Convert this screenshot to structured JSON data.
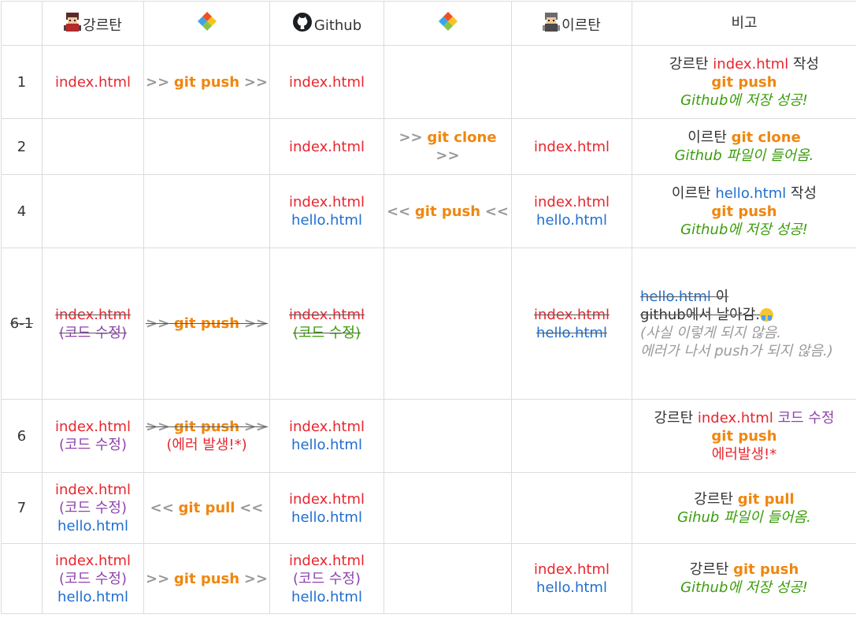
{
  "header": {
    "col1_name": "강르탄",
    "col3_name": "Github",
    "col5_name": "이르탄",
    "col6_name": "비고",
    "icons": {
      "col1": "character-icon",
      "col2": "git-logo-icon",
      "col3": "github-logo-icon",
      "col4": "git-logo-icon",
      "col5": "character-icon"
    }
  },
  "rows": [
    {
      "idx": "1",
      "c1_file": "index.html",
      "c2_arrow_l": ">>",
      "c2_cmd": "git push",
      "c2_arrow_r": ">>",
      "c3_file": "index.html",
      "note_person": "강르탄",
      "note_file": "index.html",
      "note_action": "작성",
      "note_cmd": "git push",
      "note_result": "Github에 저장 성공!"
    },
    {
      "idx": "2",
      "c3_file": "index.html",
      "c4_arrow_l": ">>",
      "c4_cmd": "git clone",
      "c4_arrow_r": ">>",
      "c5_file": "index.html",
      "note_person": "이르탄",
      "note_cmd": "git clone",
      "note_result": "Github 파일이 들어옴."
    },
    {
      "idx": "4",
      "c3_file1": "index.html",
      "c3_file2": "hello.html",
      "c4_arrow_l": "<<",
      "c4_cmd": "git push",
      "c4_arrow_r": "<<",
      "c5_file1": "index.html",
      "c5_file2": "hello.html",
      "note_person": "이르탄",
      "note_file": "hello.html",
      "note_action": "작성",
      "note_cmd": "git push",
      "note_result": "Github에 저장 성공!"
    },
    {
      "idx": "6-1",
      "c1_file": "index.html",
      "c1_edit": "(코드 수정)",
      "c2_arrow_l": ">>",
      "c2_cmd": "git push",
      "c2_arrow_r": ">>",
      "c3_file": "index.html",
      "c3_edit": "(코드 수정)",
      "c5_file1": "index.html",
      "c5_file2": "hello.html",
      "note_file": "hello.html",
      "note_text1": "이",
      "note_text2": "github에서 날아감.",
      "note_italic1": "(사실 이렇게 되지 않음.",
      "note_italic2": "에러가 나서 push가 되지 않음.)"
    },
    {
      "idx": "6",
      "c1_file": "index.html",
      "c1_edit": "(코드 수정)",
      "c2_arrow_l": ">>",
      "c2_cmd": "git push",
      "c2_arrow_r": ">>",
      "c2_error": "(에러 발생!*)",
      "c3_file1": "index.html",
      "c3_file2": "hello.html",
      "note_person": "강르탄",
      "note_file": "index.html",
      "note_edit": "코드 수정",
      "note_cmd": "git push",
      "note_error": "에러발생!*"
    },
    {
      "idx": "7",
      "c1_file1": "index.html",
      "c1_edit": "(코드 수정)",
      "c1_file2": "hello.html",
      "c2_arrow_l": "<<",
      "c2_cmd": "git pull",
      "c2_arrow_r": "<<",
      "c3_file1": "index.html",
      "c3_file2": "hello.html",
      "note_person": "강르탄",
      "note_cmd": "git pull",
      "note_result": "Gihub 파일이 들어옴."
    },
    {
      "idx": "",
      "c1_file1": "index.html",
      "c1_edit": "(코드 수정)",
      "c1_file2": "hello.html",
      "c2_arrow_l": ">>",
      "c2_cmd": "git push",
      "c2_arrow_r": ">>",
      "c3_file1": "index.html",
      "c3_edit": "(코드 수정)",
      "c3_file2": "hello.html",
      "c5_file1": "index.html",
      "c5_file2": "hello.html",
      "note_person": "강르탄",
      "note_cmd": "git push",
      "note_result": "Github에 저장 성공!"
    }
  ]
}
